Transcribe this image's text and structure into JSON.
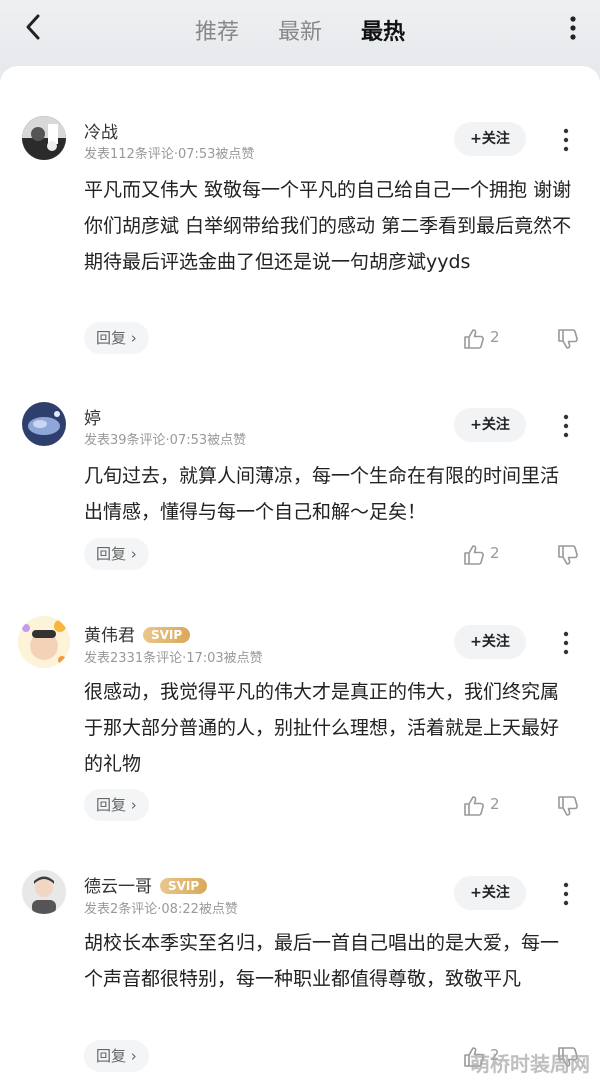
{
  "tabs": [
    "推荐",
    "最新",
    "最热"
  ],
  "active_tab": 2,
  "follow_label": "+关注",
  "reply_label": "回复 ›",
  "watermark": "萌桥时装周网",
  "comments": [
    {
      "name": "冷战",
      "svip": "",
      "meta": "发表112条评论·07:53被点赞",
      "text": "平凡而又伟大 致敬每一个平凡的自己给自己一个拥抱 谢谢你们胡彦斌 白举纲带给我们的感动 第二季看到最后竟然不期待最后评选金曲了但还是说一句胡彦斌yyds",
      "likes": "2"
    },
    {
      "name": "婷",
      "svip": "",
      "meta": "发表39条评论·07:53被点赞",
      "text": "几旬过去，就算人间薄凉，每一个生命在有限的时间里活出情感，懂得与每一个自己和解～足矣！",
      "likes": "2"
    },
    {
      "name": "黄伟君",
      "svip": "SVIP",
      "meta": "发表2331条评论·17:03被点赞",
      "text": "很感动，我觉得平凡的伟大才是真正的伟大，我们终究属于那大部分普通的人，别扯什么理想，活着就是上天最好的礼物",
      "likes": "2"
    },
    {
      "name": "德云一哥",
      "svip": "SVIP",
      "meta": "发表2条评论·08:22被点赞",
      "text": "胡校长本季实至名归，最后一首自己唱出的是大爱，每一个声音都很特别，每一种职业都值得尊敬，致敬平凡",
      "likes": "2"
    }
  ]
}
